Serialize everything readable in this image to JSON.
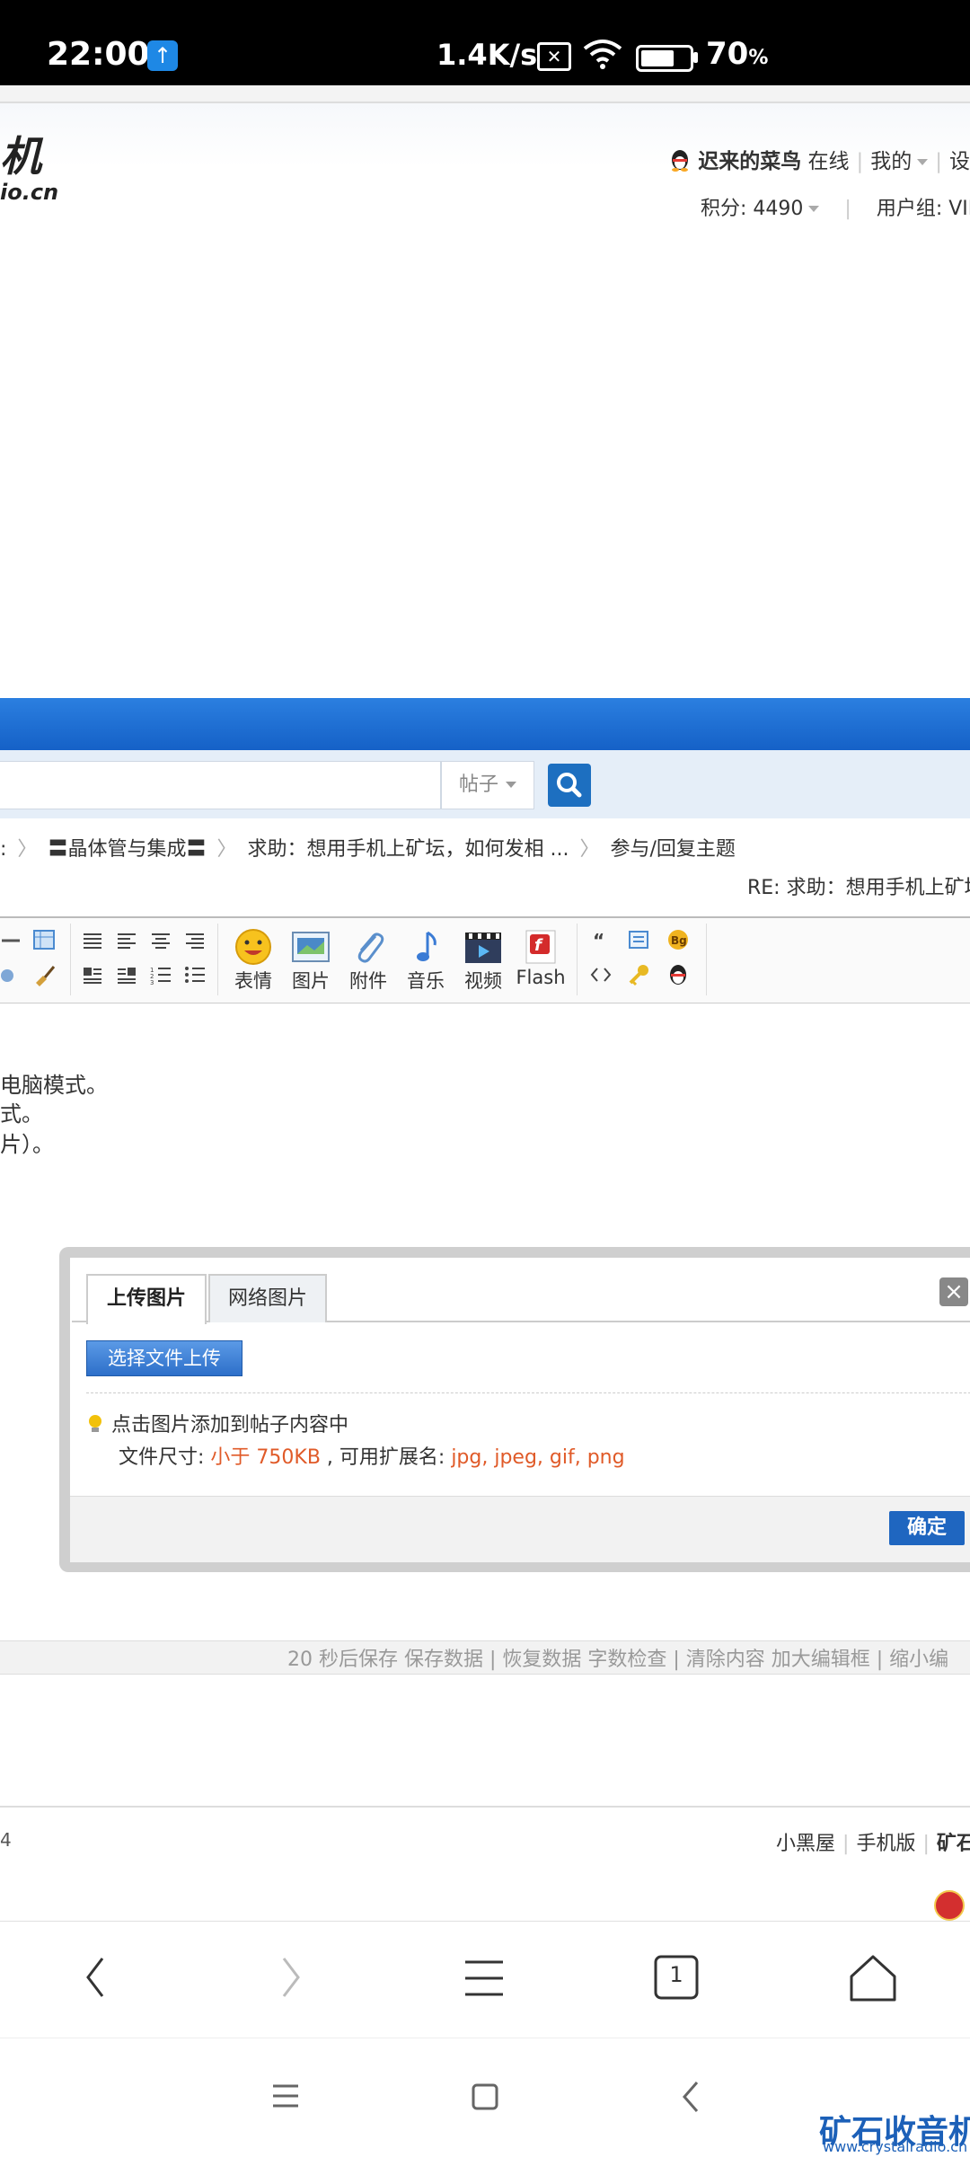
{
  "status_bar": {
    "time": "22:00",
    "net_speed": "1.4K/s",
    "battery_level": "70",
    "battery_unit": "%",
    "battery_fraction": 0.7
  },
  "header": {
    "logo_text": "机",
    "logo_sub": "io.cn",
    "username": "迟来的菜鸟",
    "online": "在线",
    "my_menu": "我的",
    "settings_partial": "设",
    "score_label": "积分: 4490",
    "usergroup": "用户组: VIP会"
  },
  "search": {
    "type_select": "帖子"
  },
  "breadcrumb": {
    "first_partial": ":",
    "forum": "〓晶体管与集成〓",
    "thread": "求助：想用手机上矿坛，如何发相 ...",
    "action": "参与/回复主题"
  },
  "reply_title": "RE: 求助：想用手机上矿坛",
  "toolbar": {
    "emoji": "表情",
    "image": "图片",
    "attachment": "附件",
    "music": "音乐",
    "video": "视频",
    "flash": "Flash"
  },
  "editor_lines": [
    "电脑模式。",
    "式。",
    "片）。"
  ],
  "dialog": {
    "tab_upload": "上传图片",
    "tab_network": "网络图片",
    "close": "×",
    "upload_button": "选择文件上传",
    "tip": "点击图片添加到帖子内容中",
    "size_label": "文件尺寸: ",
    "size_value": "小于 750KB",
    "ext_label": " , 可用扩展名: ",
    "ext_value": "jpg, jpeg, gif, png",
    "ok_button": "确定"
  },
  "save_bar": "20 秒后保存 保存数据 | 恢复数据    字数检查 | 清除内容    加大编辑框 | 缩小编",
  "footer": {
    "left_partial": "4",
    "links": [
      "小黑屋",
      "手机版"
    ],
    "brand_partial": "矿石"
  },
  "browser_nav": {
    "tab_count": "1"
  },
  "watermark": {
    "title": "矿石收音机",
    "url": "www.crystalradio.cn"
  }
}
